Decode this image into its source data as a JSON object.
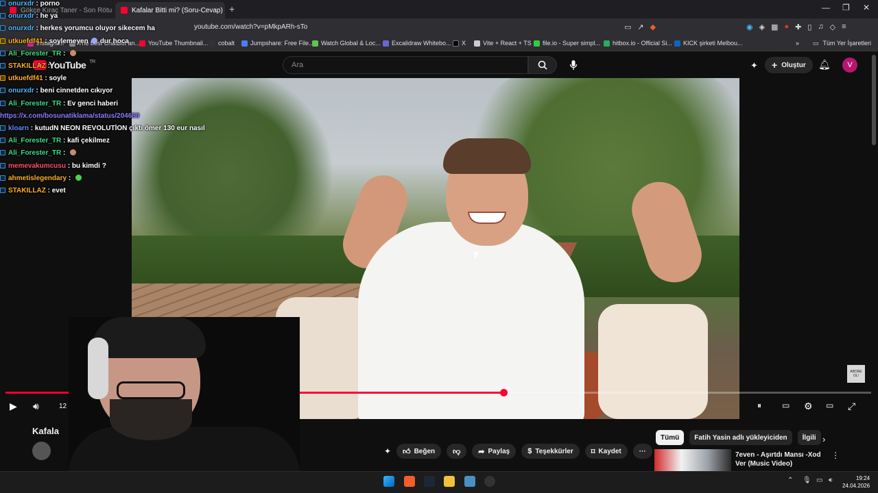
{
  "browser": {
    "tabs": [
      {
        "title": "Gökçe Kıraç Taner - Son Rötuş ( Y-E...",
        "active": false
      },
      {
        "title": "Kafalar Bitti mi? (Soru-Cevap) - Y",
        "active": true
      }
    ],
    "new_tab": "+",
    "window_controls": [
      "—",
      "❐",
      "✕"
    ],
    "url": "youtube.com/watch?v=pMkpARh-sTo",
    "bookmarks": [
      "Instagram",
      "The best ChatBot an...",
      "YouTube Thumbnail...",
      "cobalt",
      "Jumpshare: Free File...",
      "Watch Global & Loc...",
      "Excalidraw Whitebo...",
      "X",
      "Vite + React + TS",
      "file.io - Super simpl...",
      "hitbox.io - Official Si...",
      "KICK şirketi Melbou..."
    ],
    "bookmarks_overflow": "»",
    "all_bookmarks": "Tüm Yer İşaretleri"
  },
  "youtube": {
    "logo": "YouTube",
    "logo_region": "TR",
    "search_placeholder": "Ara",
    "create_label": "Oluştur",
    "avatar_letter": "V",
    "watermark": "ABONE OL!",
    "player": {
      "time_partial": "12",
      "progress_fraction": 0.575
    },
    "video_title_partial": "Kafala",
    "actions": {
      "like": "Beğen",
      "share": "Paylaş",
      "thanks": "Teşekkürler",
      "save": "Kaydet",
      "more": "···"
    },
    "chips": [
      "Tümü",
      "Fatih Yasin adlı yükleyiciden",
      "İlgili"
    ],
    "recommendation": {
      "title": "7even - Aşırtdı Mansı -Xod Ver (Music Video)"
    }
  },
  "chat": [
    {
      "user": "onurxdr",
      "text": "porno",
      "color": "#4fb8ff"
    },
    {
      "user": "onurxdr",
      "text": "he ya",
      "color": "#4fb8ff"
    },
    {
      "user": "onurxdr",
      "text": "herkes yorumcu oluyor sikecem ha",
      "color": "#4fb8ff"
    },
    {
      "user": "utkuefdf41",
      "text": "soylemeyen",
      "color": "#ffb020"
    },
    {
      "user": "Ali_Forester_TR",
      "text": "",
      "color": "#3ddc84"
    },
    {
      "user": "STAKILLAZ",
      "text": "",
      "color": "#ffb020"
    },
    {
      "user": "utkuefdf41",
      "text": "soyle",
      "color": "#ffb020"
    },
    {
      "user": "onurxdr",
      "text": "beni cinnetden cıkıyor",
      "color": "#4fb8ff"
    },
    {
      "user": "Ali_Forester_TR",
      "text": "Ev genci haberi",
      "color": "#3ddc84"
    },
    {
      "user": "",
      "text": "https://x.com/bosunatiklama/status/204689",
      "color": "#8a7bff"
    },
    {
      "user": "kloarn",
      "text": "kutudN NEON REVOLUTİON çıktı ömer 130 eur nasıl",
      "color": "#5b8cff"
    },
    {
      "user": "Ali_Forester_TR",
      "text": "kafi çekilmez",
      "color": "#3ddc84"
    },
    {
      "user": "Ali_Forester_TR",
      "text": "",
      "color": "#3ddc84"
    },
    {
      "user": "memevakumcusu",
      "text": "bu kimdi ?",
      "color": "#ff4f6a"
    },
    {
      "user": "ahmetislegendary",
      "text": "",
      "color": "#ffb020"
    },
    {
      "user": "STAKILLAZ",
      "text": "evet",
      "color": "#ffb020"
    }
  ],
  "chat_extra": {
    "dur_hoca": "dur hoca"
  },
  "taskbar": {
    "time": "19:24",
    "date": "24.04.2026"
  }
}
